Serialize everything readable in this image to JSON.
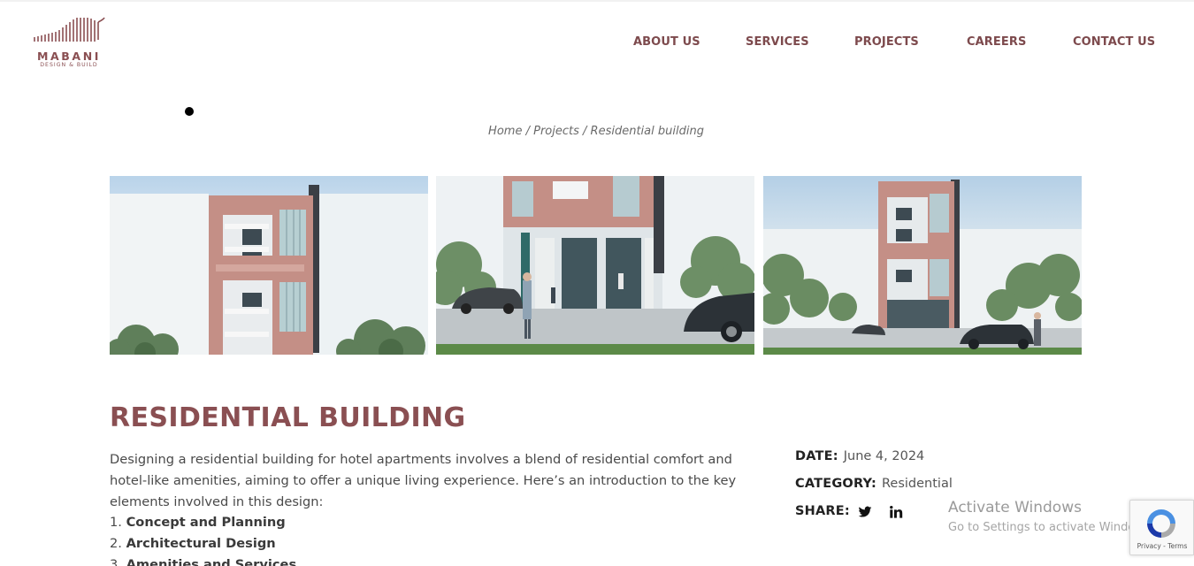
{
  "brand": {
    "name": "MABANI",
    "tagline": "DESIGN & BUILD",
    "color": "#8a4f52"
  },
  "nav": {
    "items": [
      "ABOUT US",
      "SERVICES",
      "PROJECTS",
      "CAREERS",
      "CONTACT US"
    ]
  },
  "breadcrumb": {
    "home": "Home",
    "projects": "Projects",
    "current": "Residential building",
    "separator": "/"
  },
  "gallery": [
    {
      "icon": "building-render-tower-image"
    },
    {
      "icon": "building-render-entrance-image"
    },
    {
      "icon": "building-render-street-image"
    }
  ],
  "project": {
    "title": "RESIDENTIAL BUILDING",
    "intro": "Designing a residential building for hotel apartments involves a blend of residential comfort and hotel-like amenities, aiming to offer a unique living experience. Here’s an introduction to the key elements involved in this design:",
    "list": [
      {
        "num": "1.",
        "label": "Concept and Planning"
      },
      {
        "num": "2.",
        "label": "Architectural Design"
      },
      {
        "num": "3.",
        "label": "Amenities and Services"
      }
    ]
  },
  "meta": {
    "date_label": "DATE:",
    "date_value": "June 4, 2024",
    "category_label": "CATEGORY:",
    "category_value": "Residential",
    "share_label": "SHARE:",
    "share_icons": [
      "twitter-icon",
      "linkedin-icon"
    ]
  },
  "windows_watermark": {
    "line1": "Activate Windows",
    "line2": "Go to Settings to activate Windows."
  },
  "recaptcha": {
    "links": "Privacy - Terms",
    "icon": "recaptcha-icon"
  },
  "colors": {
    "accent": "#8a4f52",
    "nav": "#7d4a4d",
    "facade": "#c48f86"
  }
}
